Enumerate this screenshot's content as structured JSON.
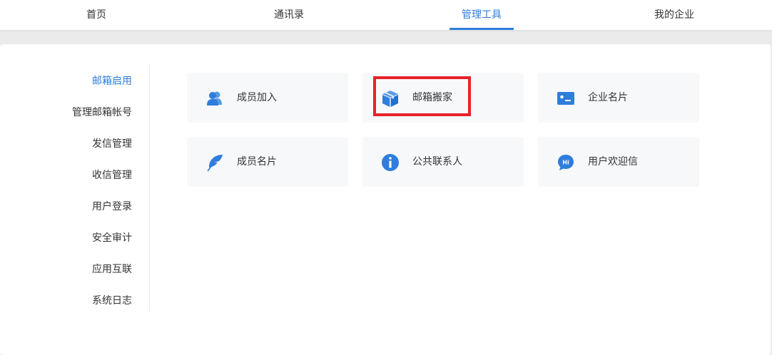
{
  "top_nav": {
    "tabs": [
      {
        "label": "首页",
        "active": false
      },
      {
        "label": "通讯录",
        "active": false
      },
      {
        "label": "管理工具",
        "active": true
      },
      {
        "label": "我的企业",
        "active": false
      }
    ]
  },
  "sidebar": {
    "items": [
      {
        "label": "邮箱启用",
        "active": true
      },
      {
        "label": "管理邮箱帐号",
        "active": false
      },
      {
        "label": "发信管理",
        "active": false
      },
      {
        "label": "收信管理",
        "active": false
      },
      {
        "label": "用户登录",
        "active": false
      },
      {
        "label": "安全审计",
        "active": false
      },
      {
        "label": "应用互联",
        "active": false
      },
      {
        "label": "系统日志",
        "active": false
      }
    ]
  },
  "tools": [
    {
      "label": "成员加入",
      "icon": "members-icon"
    },
    {
      "label": "邮箱搬家",
      "icon": "box-icon",
      "highlighted": true
    },
    {
      "label": "企业名片",
      "icon": "business-card-icon"
    },
    {
      "label": "成员名片",
      "icon": "feather-icon"
    },
    {
      "label": "公共联系人",
      "icon": "info-icon"
    },
    {
      "label": "用户欢迎信",
      "icon": "hi-chat-icon"
    }
  ],
  "colors": {
    "accent": "#2f7ddc",
    "icon": "#2f7ddc",
    "highlight": "#e8212b",
    "tile_bg": "#f7f8fa"
  }
}
